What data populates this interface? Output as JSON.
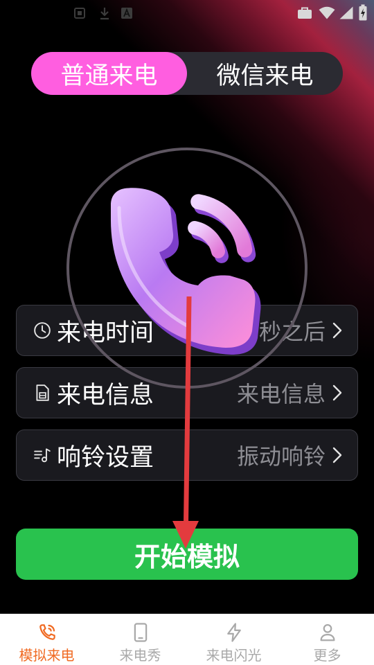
{
  "theme": {
    "toggle_active": "#ff5ee0",
    "start_button": "#29c24e",
    "nav_active": "#f06a22",
    "nav_inactive": "#a9a9a9",
    "annotation_arrow": "#e33b3e",
    "value_text": "#8e8e94",
    "ring": "#5e5661"
  },
  "status_bar": {
    "icons_left": [
      "notification-icon",
      "download-icon",
      "app-icon"
    ],
    "icons_right": [
      "briefcase-icon",
      "wifi-icon",
      "signal-icon",
      "battery-charging-icon"
    ]
  },
  "call_type_toggle": {
    "options": [
      {
        "label": "普通来电",
        "active": true
      },
      {
        "label": "微信来电",
        "active": false
      }
    ]
  },
  "hero": {
    "icon": "phone-ringing-icon"
  },
  "settings": [
    {
      "icon": "clock-icon",
      "label": "来电时间",
      "value": "15秒之后"
    },
    {
      "icon": "sim-card-icon",
      "label": "来电信息",
      "value": "来电信息"
    },
    {
      "icon": "music-note-icon",
      "label": "响铃设置",
      "value": "振动响铃"
    }
  ],
  "start_button": {
    "label": "开始模拟"
  },
  "bottom_nav": {
    "items": [
      {
        "icon": "phone-call-icon",
        "label": "模拟来电",
        "active": true
      },
      {
        "icon": "smartphone-icon",
        "label": "来电秀",
        "active": false
      },
      {
        "icon": "lightning-icon",
        "label": "来电闪光",
        "active": false
      },
      {
        "icon": "person-icon",
        "label": "更多",
        "active": false
      }
    ]
  }
}
